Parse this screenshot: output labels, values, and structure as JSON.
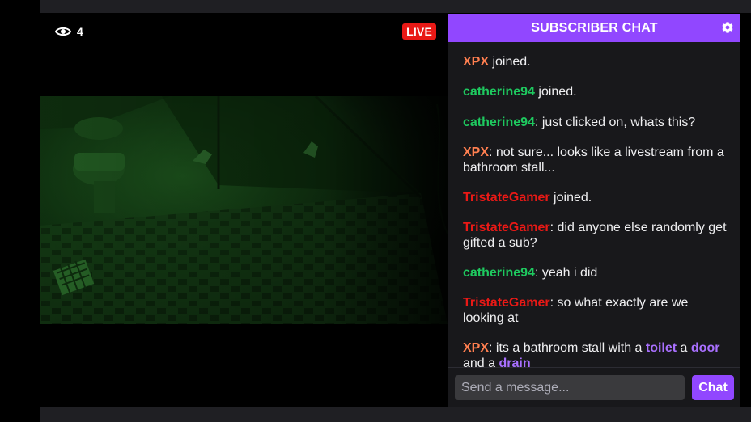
{
  "stream": {
    "viewer_count": "4",
    "live_label": "LIVE"
  },
  "chat": {
    "title": "SUBSCRIBER CHAT",
    "messages": [
      {
        "user": "XPX",
        "text": " joined.",
        "color": "#ff7f50"
      },
      {
        "user": "catherine94",
        "text": " joined.",
        "color": "#1ec95f"
      },
      {
        "user": "catherine94",
        "text": ": just clicked on, whats this?",
        "color": "#1ec95f"
      },
      {
        "user": "XPX",
        "text": ": not sure... looks like a livestream from a bathroom stall...",
        "color": "#ff7f50"
      },
      {
        "user": "TristateGamer",
        "text": " joined.",
        "color": "#e91916"
      },
      {
        "user": "TristateGamer",
        "text": ": did anyone else randomly get gifted a sub?",
        "color": "#e91916"
      },
      {
        "user": "catherine94",
        "text": ": yeah i did",
        "color": "#1ec95f"
      },
      {
        "user": "TristateGamer",
        "text": ": so what exactly are we looking at",
        "color": "#e91916"
      },
      {
        "user": "XPX",
        "parts": [
          ": its a bathroom stall with a ",
          "toilet",
          " a ",
          "door",
          " and a ",
          "drain"
        ],
        "color": "#ff7f50"
      }
    ],
    "input_placeholder": "Send a message...",
    "send_label": "Chat"
  },
  "colors": {
    "accent": "#9147ff",
    "live": "#e91916",
    "keyword": "#a970ff"
  }
}
